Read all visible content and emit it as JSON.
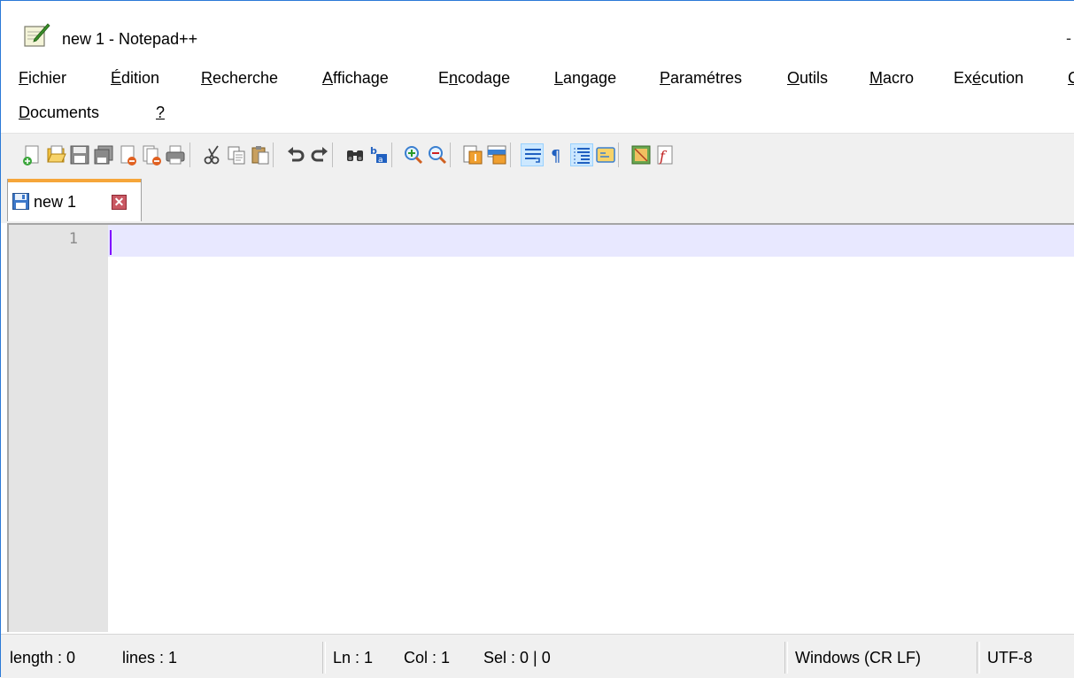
{
  "window": {
    "title": "new 1 - Notepad++",
    "minimize_glyph": "-"
  },
  "menu": {
    "row1": [
      {
        "pre": "",
        "mn": "F",
        "post": "ichier"
      },
      {
        "pre": "",
        "mn": "É",
        "post": "dition"
      },
      {
        "pre": "",
        "mn": "R",
        "post": "echerche"
      },
      {
        "pre": "",
        "mn": "A",
        "post": "ffichage"
      },
      {
        "pre": "E",
        "mn": "n",
        "post": "codage"
      },
      {
        "pre": "",
        "mn": "L",
        "post": "angage"
      },
      {
        "pre": "",
        "mn": "P",
        "post": "aramétres"
      },
      {
        "pre": "",
        "mn": "O",
        "post": "utils"
      },
      {
        "pre": "",
        "mn": "M",
        "post": "acro"
      },
      {
        "pre": "Ex",
        "mn": "é",
        "post": "cution"
      },
      {
        "pre": "",
        "mn": "C",
        "post": ""
      }
    ],
    "row2": [
      {
        "pre": "",
        "mn": "D",
        "post": "ocuments"
      },
      {
        "pre": "",
        "mn": "?",
        "post": ""
      }
    ]
  },
  "toolbar": {
    "buttons": [
      {
        "name": "new-file-icon"
      },
      {
        "name": "open-file-icon"
      },
      {
        "name": "save-icon"
      },
      {
        "name": "save-all-icon"
      },
      {
        "name": "close-icon"
      },
      {
        "name": "close-all-icon"
      },
      {
        "name": "print-icon"
      },
      {
        "name": "cut-icon"
      },
      {
        "name": "copy-icon"
      },
      {
        "name": "paste-icon"
      },
      {
        "name": "undo-icon"
      },
      {
        "name": "redo-icon"
      },
      {
        "name": "find-icon"
      },
      {
        "name": "replace-icon"
      },
      {
        "name": "zoom-in-icon"
      },
      {
        "name": "zoom-out-icon"
      },
      {
        "name": "sync-vertical-icon"
      },
      {
        "name": "sync-horizontal-icon"
      },
      {
        "name": "word-wrap-icon",
        "active": true
      },
      {
        "name": "show-all-characters-icon"
      },
      {
        "name": "indent-guide-icon",
        "active": true
      },
      {
        "name": "user-defined-language-icon"
      },
      {
        "name": "document-map-icon"
      },
      {
        "name": "function-list-icon"
      }
    ]
  },
  "tabs": [
    {
      "label": "new 1",
      "close_glyph": "✕"
    }
  ],
  "editor": {
    "line_numbers": [
      "1"
    ]
  },
  "status": {
    "length": "length : 0",
    "lines": "lines : 1",
    "ln": "Ln : 1",
    "col": "Col : 1",
    "sel": "Sel : 0 | 0",
    "eol": "Windows (CR LF)",
    "encoding": "UTF-8"
  }
}
